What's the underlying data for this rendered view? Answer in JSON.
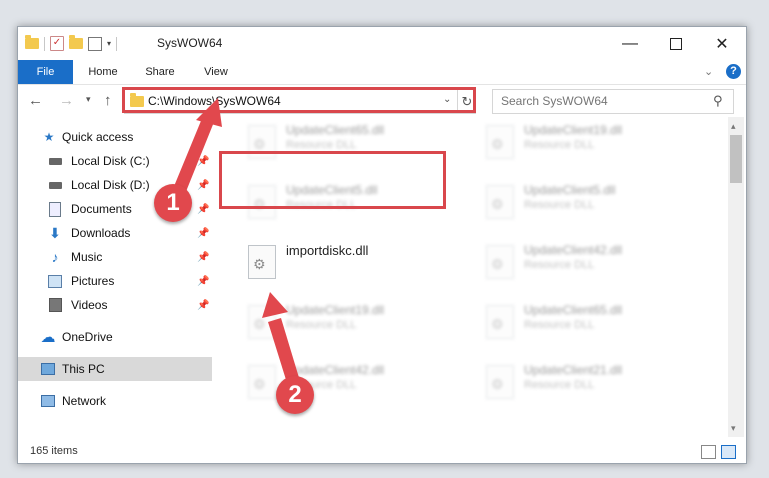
{
  "window": {
    "title": "SysWOW64"
  },
  "titlebar": {
    "min_glyph": "—",
    "close_glyph": "✕",
    "qat_check_glyph": "✓",
    "qat_dropdown_glyph": "▾"
  },
  "ribbon": {
    "tabs": [
      {
        "label": "File"
      },
      {
        "label": "Home"
      },
      {
        "label": "Share"
      },
      {
        "label": "View"
      }
    ],
    "collapse_glyph": "⌄",
    "help_glyph": "?"
  },
  "nav": {
    "back_glyph": "←",
    "forward_glyph": "→",
    "recent_glyph": "▾",
    "up_glyph": "↑",
    "address": "C:\\Windows\\SysWOW64",
    "address_dropdown_glyph": "⌄",
    "refresh_glyph": "↻",
    "search_placeholder": "Search SysWOW64",
    "search_glyph": "⚲"
  },
  "sidebar": {
    "items": [
      {
        "label": "Quick access",
        "icon": "star-icon"
      },
      {
        "label": "Local Disk (C:)",
        "icon": "drive-icon"
      },
      {
        "label": "Local Disk (D:)",
        "icon": "drive-icon"
      },
      {
        "label": "Documents",
        "icon": "document-icon"
      },
      {
        "label": "Downloads",
        "icon": "download-icon"
      },
      {
        "label": "Music",
        "icon": "music-icon"
      },
      {
        "label": "Pictures",
        "icon": "pictures-icon"
      },
      {
        "label": "Videos",
        "icon": "video-icon"
      },
      {
        "label": "OneDrive",
        "icon": "cloud-icon"
      },
      {
        "label": "This PC",
        "icon": "computer-icon"
      },
      {
        "label": "Network",
        "icon": "network-icon"
      }
    ],
    "pin_glyph": "📌"
  },
  "files": {
    "col1": [
      {
        "name": "UpdateClient65.dll",
        "type": "Resource DLL"
      },
      {
        "name": "UpdateClient5.dll",
        "type": "Resource DLL"
      },
      {
        "name": "importdiskc.dll",
        "type": ""
      },
      {
        "name": "UpdateClient19.dll",
        "type": "Resource DLL"
      },
      {
        "name": "UpdateClient42.dll",
        "type": "Resource DLL"
      }
    ],
    "col2": [
      {
        "name": "UpdateClient19.dll",
        "type": "Resource DLL"
      },
      {
        "name": "UpdateClient5.dll",
        "type": "Resource DLL"
      },
      {
        "name": "UpdateClient42.dll",
        "type": "Resource DLL"
      },
      {
        "name": "UpdateClient65.dll",
        "type": "Resource DLL"
      },
      {
        "name": "UpdateClient21.dll",
        "type": "Resource DLL"
      }
    ]
  },
  "scrollbar": {
    "up_glyph": "▴",
    "down_glyph": "▾"
  },
  "status": {
    "item_count": "165 items"
  },
  "annotations": {
    "step1": "1",
    "step2": "2",
    "color": "#d9474c"
  }
}
